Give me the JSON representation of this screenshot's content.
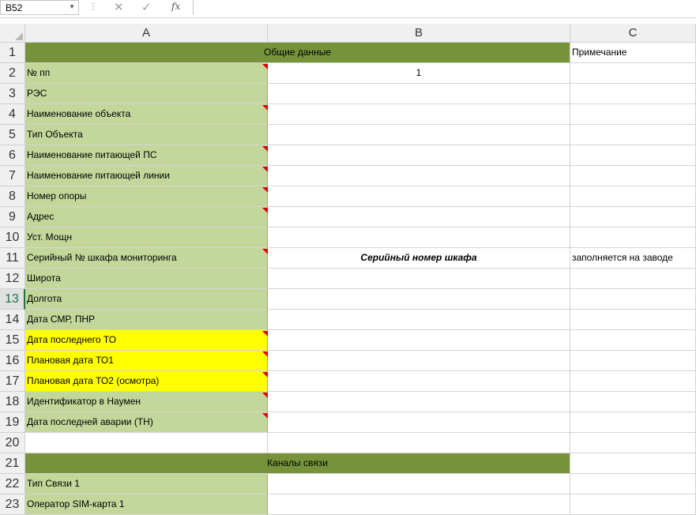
{
  "formula_bar": {
    "name_box": "B52",
    "fx_label": "fx"
  },
  "columns": [
    "A",
    "B",
    "C"
  ],
  "rows": [
    {
      "num": "1",
      "merged": "Общие данные",
      "c": "Примечание"
    },
    {
      "num": "2",
      "a": "№ пп",
      "b": "1",
      "c": ""
    },
    {
      "num": "3",
      "a": "РЭС",
      "b": "",
      "c": ""
    },
    {
      "num": "4",
      "a": "Наименование объекта",
      "b": "",
      "c": ""
    },
    {
      "num": "5",
      "a": "Тип Объекта",
      "b": "",
      "c": ""
    },
    {
      "num": "6",
      "a": "Наименование питающей ПС",
      "b": "",
      "c": ""
    },
    {
      "num": "7",
      "a": "Наименование питающей линии",
      "b": "",
      "c": ""
    },
    {
      "num": "8",
      "a": "Номер опоры",
      "b": "",
      "c": ""
    },
    {
      "num": "9",
      "a": "Адрес",
      "b": "",
      "c": ""
    },
    {
      "num": "10",
      "a": "Уст. Мощн",
      "b": "",
      "c": ""
    },
    {
      "num": "11",
      "a": "Серийный № шкафа мониторинга",
      "b": "Серийный номер шкафа",
      "c": "заполняется на заводе"
    },
    {
      "num": "12",
      "a": "Широта",
      "b": "",
      "c": ""
    },
    {
      "num": "13",
      "a": "Долгота",
      "b": "",
      "c": ""
    },
    {
      "num": "14",
      "a": "Дата СМР, ПНР",
      "b": "",
      "c": ""
    },
    {
      "num": "15",
      "a": "Дата последнего ТО",
      "b": "",
      "c": ""
    },
    {
      "num": "16",
      "a": "Плановая дата ТО1",
      "b": "",
      "c": ""
    },
    {
      "num": "17",
      "a": "Плановая дата ТО2 (осмотра)",
      "b": "",
      "c": ""
    },
    {
      "num": "18",
      "a": "Идентификатор в Наумен",
      "b": "",
      "c": ""
    },
    {
      "num": "19",
      "a": "Дата последней аварии (ТН)",
      "b": "",
      "c": ""
    },
    {
      "num": "20",
      "a": "",
      "b": "",
      "c": ""
    },
    {
      "num": "21",
      "merged": "Каналы связи",
      "c": ""
    },
    {
      "num": "22",
      "a": "Тип Связи 1",
      "b": "",
      "c": ""
    },
    {
      "num": "23",
      "a": "Оператор SIM-карта 1",
      "b": "",
      "c": ""
    }
  ],
  "colors": {
    "header_green": "#76933c",
    "label_green": "#c4d79b",
    "highlight_yellow": "#ffff00",
    "comment_marker": "#e00000"
  }
}
